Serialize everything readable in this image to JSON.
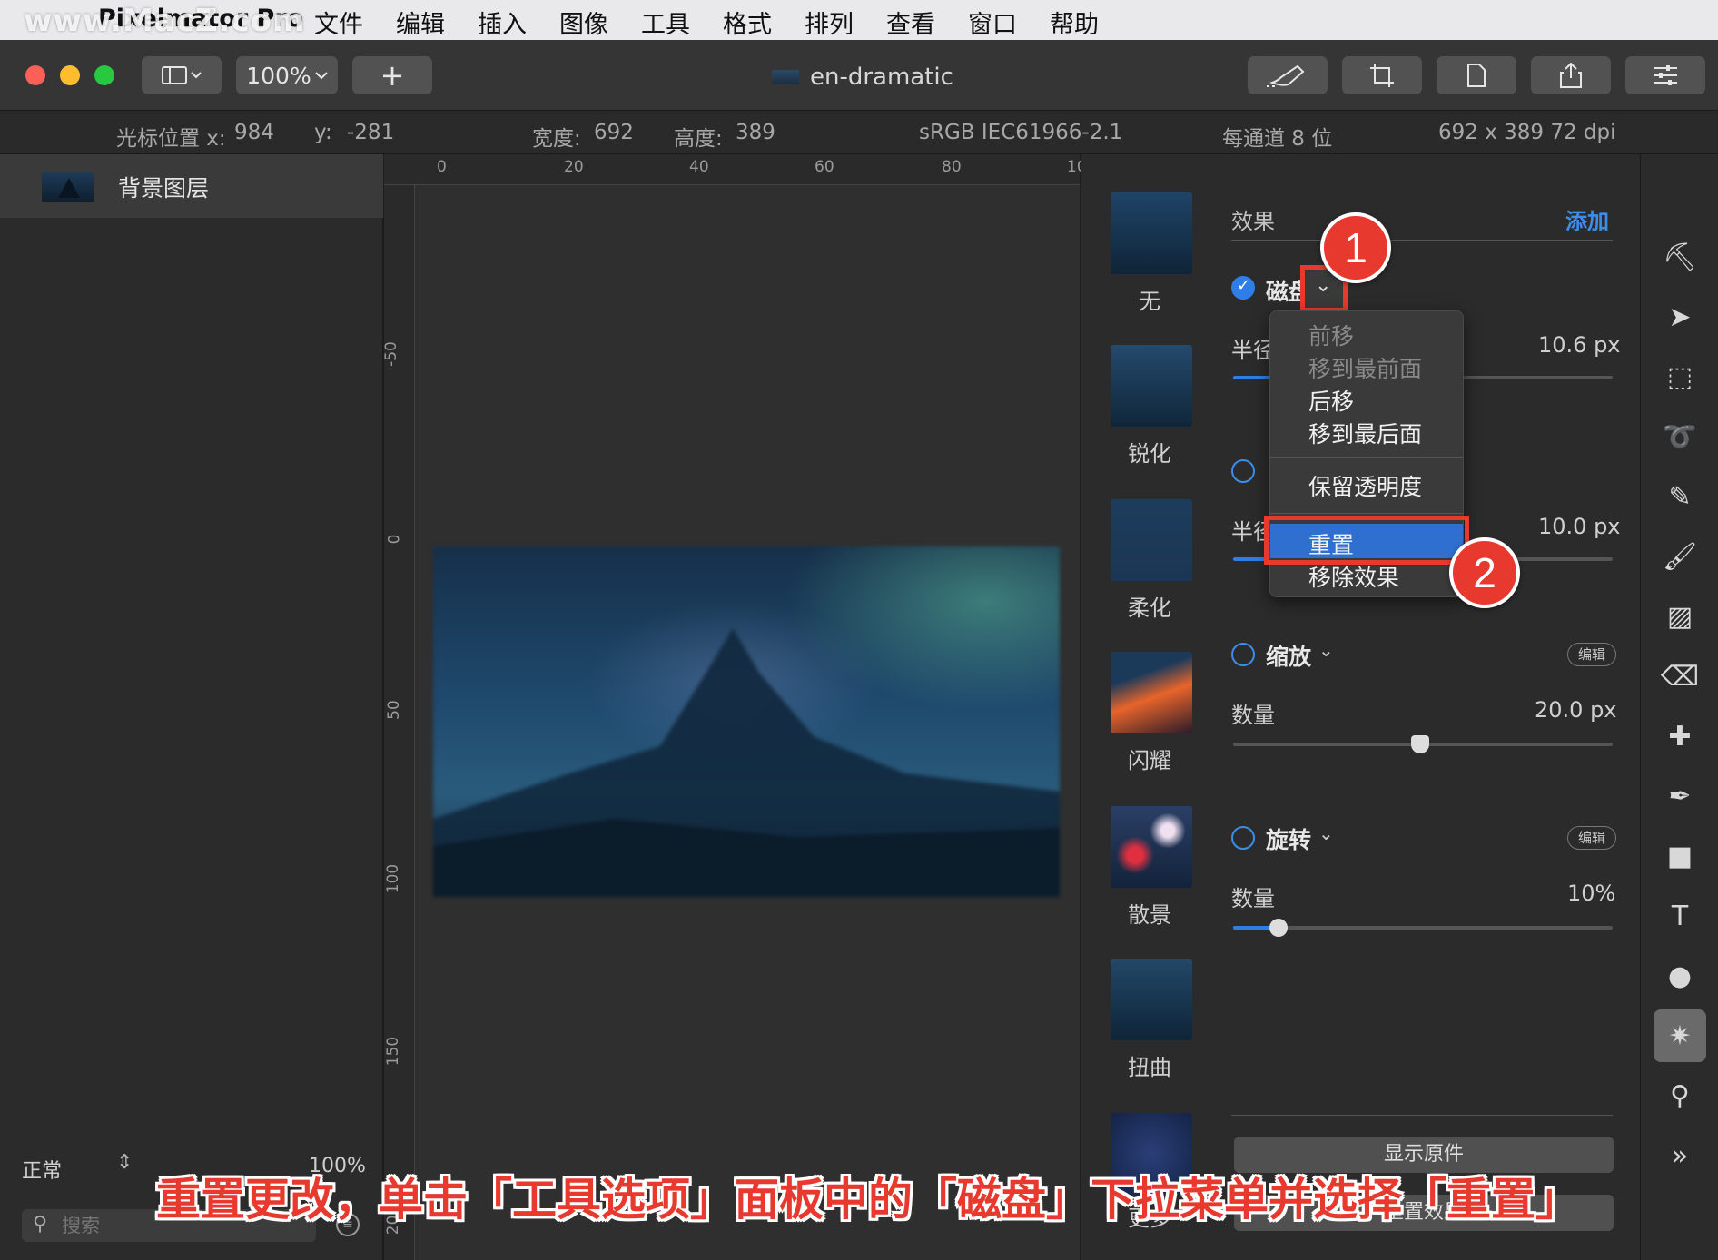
{
  "menubar": {
    "app_name": "Pixelmator Pro",
    "items": [
      "文件",
      "编辑",
      "插入",
      "图像",
      "工具",
      "格式",
      "排列",
      "查看",
      "窗口",
      "帮助"
    ],
    "watermark": "www.MacZ.com"
  },
  "toolbar": {
    "zoom": "100%",
    "add_label": "+",
    "doc_title": "en-dramatic"
  },
  "infobar": {
    "cursor_x_label": "光标位置 x:",
    "cursor_x": "984",
    "cursor_y_label": "y:",
    "cursor_y": "-281",
    "width_label": "宽度:",
    "width": "692",
    "height_label": "高度:",
    "height": "389",
    "color_profile": "sRGB IEC61966-2.1",
    "bit_depth": "每通道 8 位",
    "resolution": "692 x 389 72 dpi"
  },
  "layers": {
    "items": [
      {
        "name": "背景图层"
      }
    ],
    "blend_mode": "正常",
    "opacity": "100%",
    "search_placeholder": "搜索"
  },
  "rulers": {
    "top": [
      "0",
      "20",
      "40",
      "60",
      "80",
      "10"
    ],
    "left": [
      "-50",
      "0",
      "50",
      "100",
      "150",
      "200"
    ]
  },
  "effects_browser": {
    "items": [
      "无",
      "锐化",
      "柔化",
      "闪耀",
      "散景",
      "扭曲",
      "更多"
    ]
  },
  "options": {
    "section_title": "效果",
    "add_label": "添加",
    "effect1": {
      "name": "磁盘",
      "param_label": "半径",
      "param_value": "10.6 px"
    },
    "effect2": {
      "param_label": "半径",
      "param_value": "10.0 px"
    },
    "effect3": {
      "name": "缩放",
      "edit_label": "编辑",
      "param_label": "数量",
      "param_value": "20.0 px"
    },
    "effect4": {
      "name": "旋转",
      "edit_label": "编辑",
      "param_label": "数量",
      "param_value": "10%"
    },
    "show_original": "显示原件",
    "reset_effects": "重置效果"
  },
  "dropdown": {
    "items": [
      {
        "label": "前移",
        "enabled": false
      },
      {
        "label": "移到最前面",
        "enabled": false
      },
      {
        "label": "后移",
        "enabled": true
      },
      {
        "label": "移到最后面",
        "enabled": true
      },
      {
        "label": "保留透明度",
        "enabled": true
      },
      {
        "label": "重置",
        "enabled": true,
        "highlighted": true
      },
      {
        "label": "移除效果",
        "enabled": true
      }
    ]
  },
  "annotations": {
    "step1": "1",
    "step2": "2",
    "caption": "重置更改，单击「工具选项」面板中的「磁盘」下拉菜单并选择「重置」"
  },
  "colors": {
    "accent": "#2f7ee8",
    "annotation_red": "#e8392f"
  }
}
